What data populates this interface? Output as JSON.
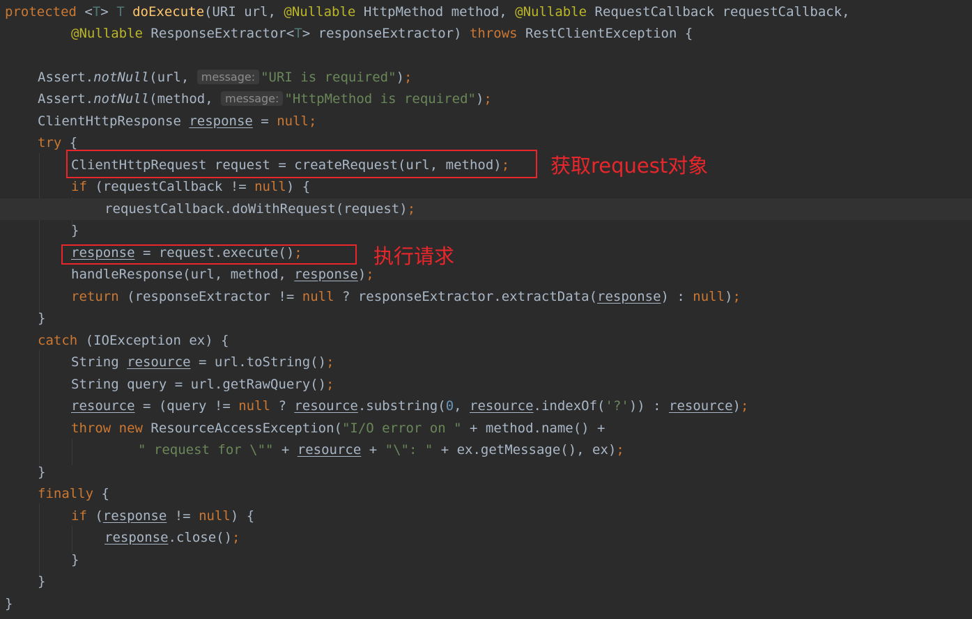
{
  "code": {
    "l1": {
      "protected": "protected",
      "lt": " <",
      "T1": "T",
      "gt": "> ",
      "T2": "T ",
      "method_name": "doExecute",
      "p1": "(URI url, ",
      "ann1": "@Nullable",
      "p2": " HttpMethod method, ",
      "ann2": "@Nullable",
      "p3": " RequestCallback requestCallback,"
    },
    "l2": {
      "ann": "@Nullable",
      "p1": " ResponseExtractor<",
      "T": "T",
      "p2": "> responseExtractor) ",
      "throws": "throws",
      "p3": " RestClientException {"
    },
    "l4": {
      "p1": "Assert.",
      "fn": "notNull",
      "p2": "(url, ",
      "hint": "message:",
      "str": "\"URI is required\"",
      "p3": ")",
      "semi": ";"
    },
    "l5": {
      "p1": "Assert.",
      "fn": "notNull",
      "p2": "(method, ",
      "hint": "message:",
      "str": "\"HttpMethod is required\"",
      "p3": ")",
      "semi": ";"
    },
    "l6": {
      "p1": "ClientHttpResponse ",
      "var": "response",
      "p2": " = ",
      "null": "null",
      "semi": ";"
    },
    "l7": {
      "try": "try",
      "p1": " {"
    },
    "l8": {
      "p1": "ClientHttpRequest request = createRequest(url, method)",
      "semi": ";"
    },
    "l9": {
      "if": "if",
      "p1": " (requestCallback != ",
      "null": "null",
      "p2": ") {"
    },
    "l10": {
      "p1": "requestCallback.doWithRequest(request)",
      "semi": ";"
    },
    "l11": {
      "p1": "}"
    },
    "l12": {
      "var": "response",
      "p1": " = request.execute()",
      "semi": ";"
    },
    "l13": {
      "p1": "handleResponse(url, method, ",
      "var": "response",
      "p2": ")",
      "semi": ";"
    },
    "l14": {
      "return": "return",
      "p1": " (responseExtractor != ",
      "null1": "null",
      "p2": " ? responseExtractor.extractData(",
      "var": "response",
      "p3": ") : ",
      "null2": "null",
      "p4": ")",
      "semi": ";"
    },
    "l15": {
      "p1": "}"
    },
    "l16": {
      "catch": "catch",
      "p1": " (IOException ex) {"
    },
    "l17": {
      "p1": "String ",
      "var": "resource",
      "p2": " = url.toString()",
      "semi": ";"
    },
    "l18": {
      "p1": "String query = url.getRawQuery()",
      "semi": ";"
    },
    "l19": {
      "var1": "resource",
      "p1": " = (query != ",
      "null": "null",
      "p2": " ? ",
      "var2": "resource",
      "p3": ".substring(",
      "num": "0",
      "p4": ", ",
      "var3": "resource",
      "p5": ".indexOf(",
      "str": "'?'",
      "p6": ")) : ",
      "var4": "resource",
      "p7": ")",
      "semi": ";"
    },
    "l20": {
      "throw": "throw",
      "sp": " ",
      "new": "new",
      "p1": " ResourceAccessException(",
      "str": "\"I/O error on \"",
      "p2": " + method.name() +"
    },
    "l21": {
      "str1": "\" request for \\\"\"",
      "p1": " + ",
      "var": "resource",
      "p2": " + ",
      "str2": "\"\\\": \"",
      "p3": " + ex.getMessage(), ex)",
      "semi": ";"
    },
    "l22": {
      "p1": "}"
    },
    "l23": {
      "finally": "finally",
      "p1": " {"
    },
    "l24": {
      "if": "if",
      "p1": " (",
      "var": "response",
      "p2": " != ",
      "null": "null",
      "p3": ") {"
    },
    "l25": {
      "var": "response",
      "p1": ".close()",
      "semi": ";"
    },
    "l26": {
      "p1": "}"
    },
    "l27": {
      "p1": "}"
    },
    "l28": {
      "p1": "}"
    }
  },
  "annotations": {
    "get_request": "获取request对象",
    "execute_request": "执行请求"
  },
  "colors": {
    "background": "#2b2b2b",
    "keyword": "#cc7832",
    "annotation": "#bbb529",
    "method_decl": "#ffc66d",
    "string": "#6a8759",
    "number": "#6897bb",
    "text": "#a9b7c6",
    "markup_red": "#e8262b"
  }
}
